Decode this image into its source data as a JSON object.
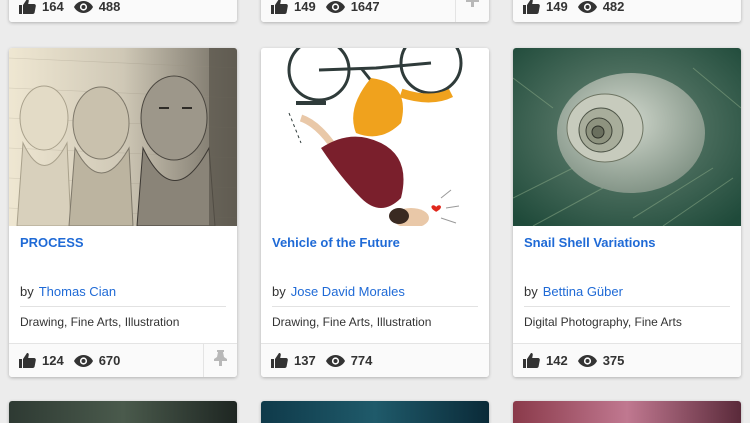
{
  "top_row": [
    {
      "likes": "164",
      "views": "488",
      "has_feature": false
    },
    {
      "likes": "149",
      "views": "1647",
      "has_feature": true
    },
    {
      "likes": "149",
      "views": "482",
      "has_feature": false
    }
  ],
  "cards": [
    {
      "title": "PROCESS",
      "by": "by",
      "author": "Thomas Cian",
      "fields": "Drawing, Fine Arts, Illustration",
      "likes": "124",
      "views": "670",
      "has_feature": true
    },
    {
      "title": "Vehicle of the Future",
      "by": "by",
      "author": "Jose David Morales",
      "fields": "Drawing, Fine Arts, Illustration",
      "likes": "137",
      "views": "774",
      "has_feature": false
    },
    {
      "title": "Snail Shell Variations",
      "by": "by",
      "author": "Bettina Güber",
      "fields": "Digital Photography, Fine Arts",
      "likes": "142",
      "views": "375",
      "has_feature": false
    }
  ],
  "colors": {
    "link": "#1f6ad6",
    "background": "#ececec"
  },
  "icons": [
    "thumbs-up-icon",
    "eye-icon",
    "feature-pin-icon"
  ]
}
